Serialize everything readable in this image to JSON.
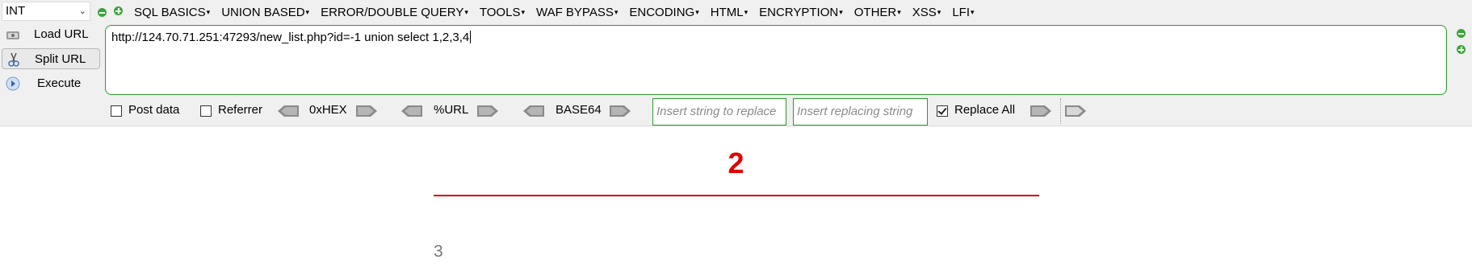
{
  "type_select": {
    "value": "INT"
  },
  "menu": [
    "SQL BASICS",
    "UNION BASED",
    "ERROR/DOUBLE QUERY",
    "TOOLS",
    "WAF BYPASS",
    "ENCODING",
    "HTML",
    "ENCRYPTION",
    "OTHER",
    "XSS",
    "LFI"
  ],
  "side": {
    "load_url": "Load URL",
    "split_url": "Split URL",
    "execute": "Execute"
  },
  "url": "http://124.70.71.251:47293/new_list.php?id=-1 union select 1,2,3,4",
  "options": {
    "post_data": "Post data",
    "referrer": "Referrer",
    "hex": "0xHEX",
    "url": "%URL",
    "base64": "BASE64",
    "replace_placeholder": "Insert string to replace",
    "replacing_placeholder": "Insert replacing string",
    "replace_all": "Replace All",
    "replace_all_checked": true,
    "post_data_checked": false,
    "referrer_checked": false
  },
  "colors": {
    "accent_green": "#2e9a2e",
    "result_red": "#e00000"
  },
  "page": {
    "big_number": "2",
    "small_number": "3"
  }
}
